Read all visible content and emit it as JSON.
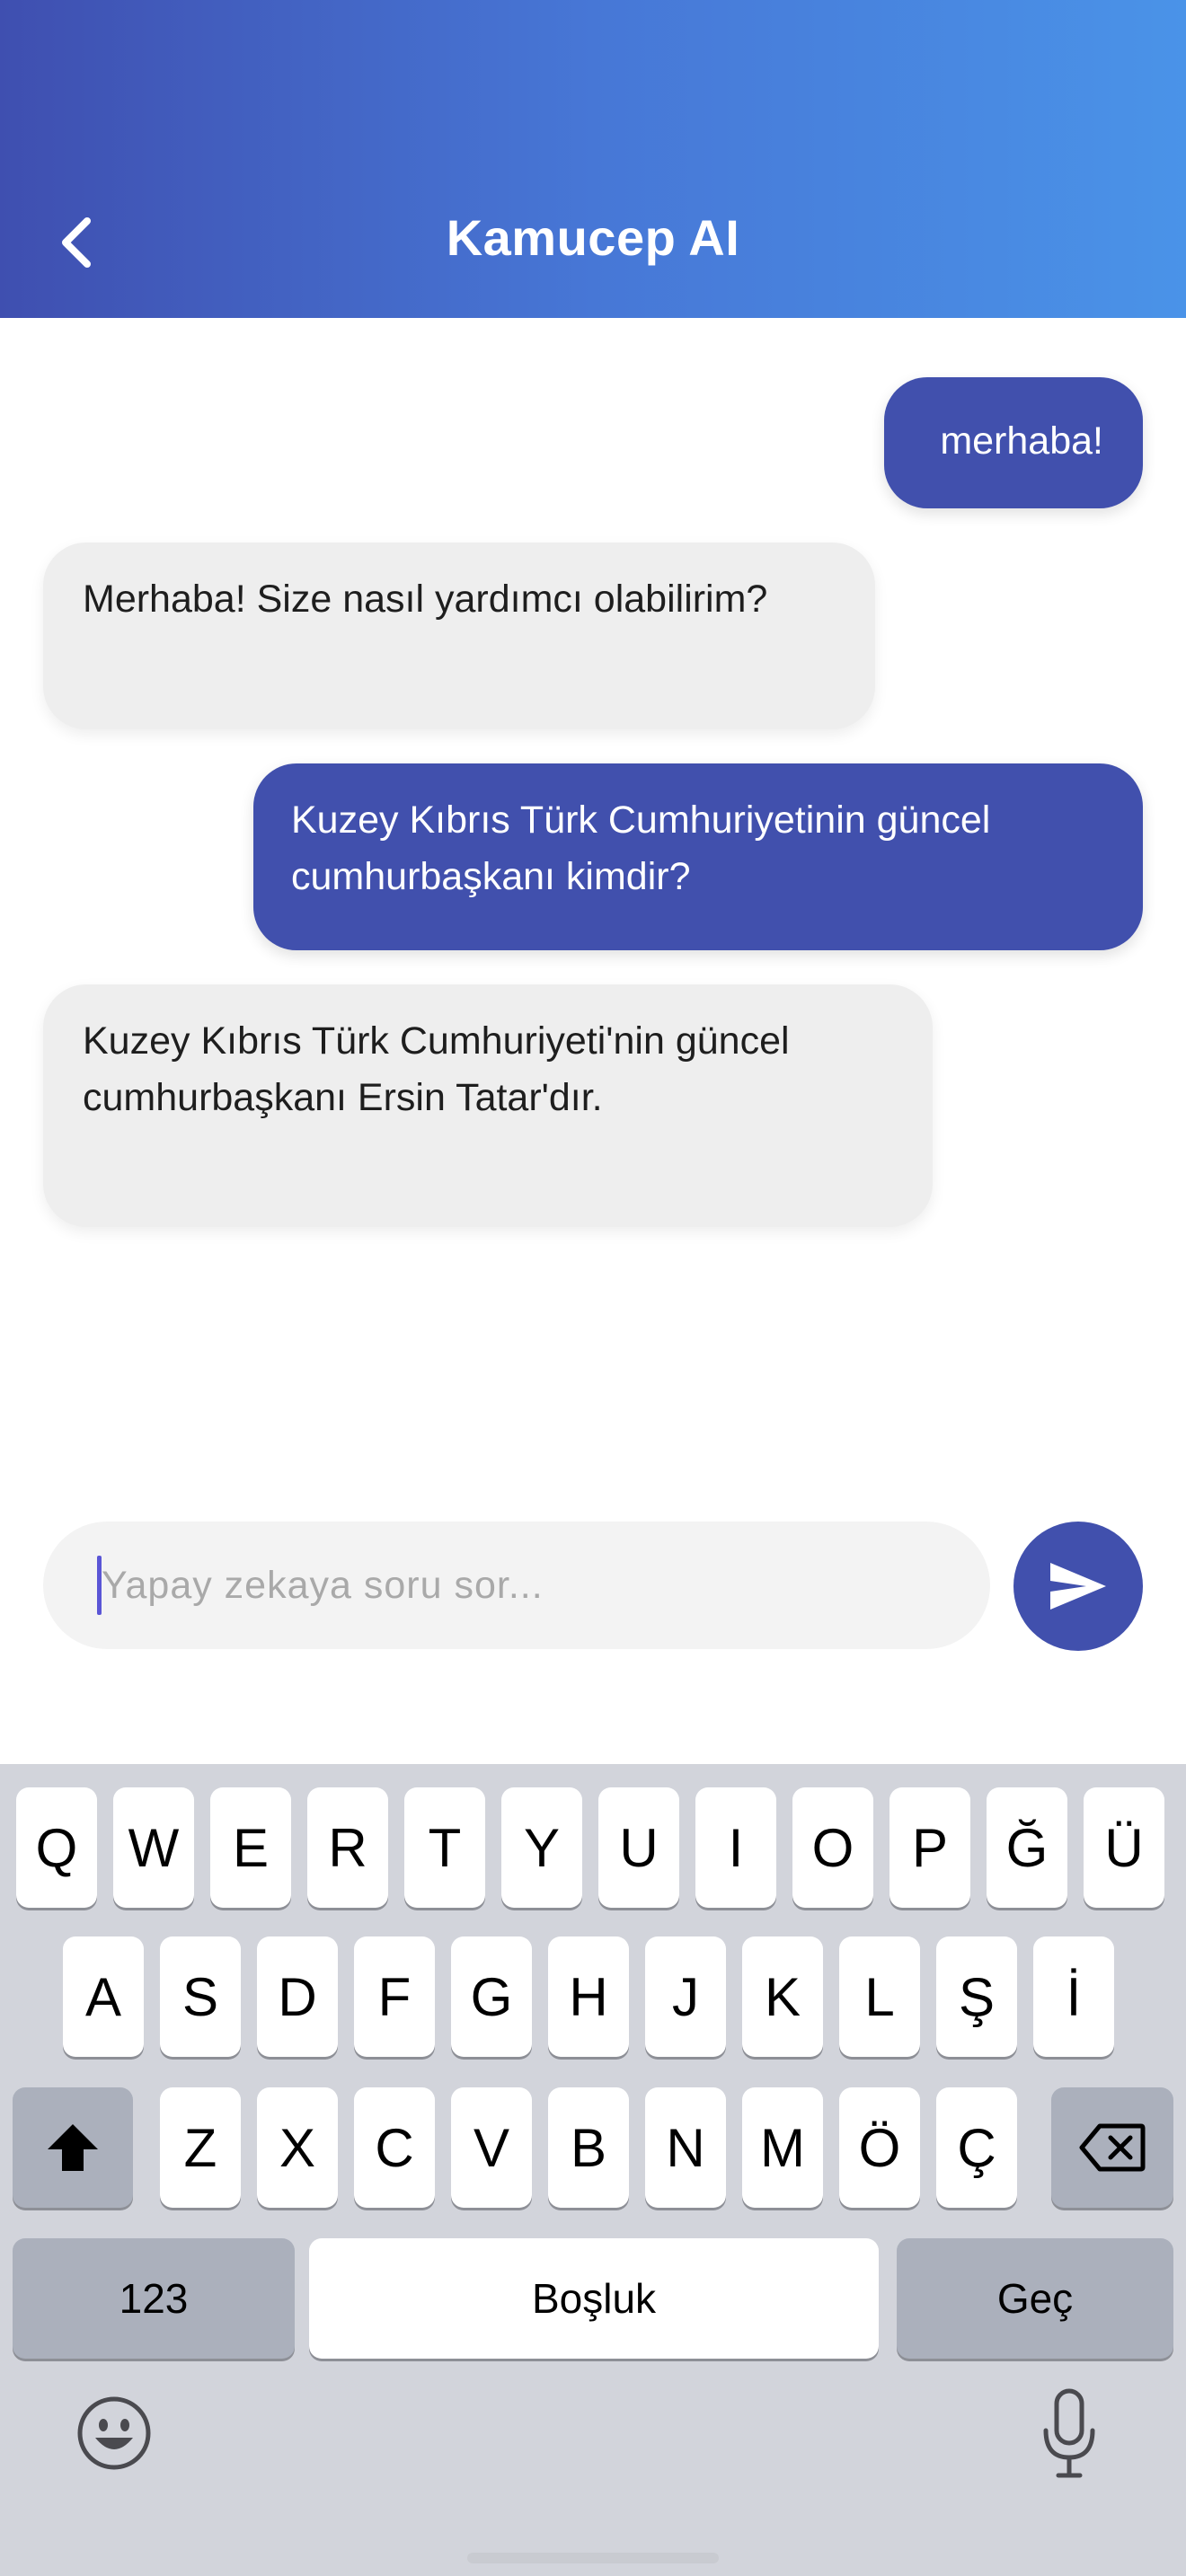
{
  "header": {
    "title": "Kamucep AI",
    "back_icon": "chevron-left-icon"
  },
  "messages": [
    {
      "role": "user",
      "text": "merhaba!"
    },
    {
      "role": "bot",
      "text": "Merhaba!  Size nasıl yardımcı olabilirim?"
    },
    {
      "role": "user",
      "line1": "Kuzey Kıbrıs Türk Cumhuriyetinin güncel",
      "line2": "cumhurbaşkanı kimdir?"
    },
    {
      "role": "bot",
      "line1": "Kuzey Kıbrıs Türk Cumhuriyeti'nin güncel",
      "line2": "cumhurbaşkanı Ersin Tatar'dır."
    }
  ],
  "composer": {
    "placeholder": "Yapay zekaya soru sor...",
    "send_icon": "send-icon"
  },
  "keyboard": {
    "row1": [
      "Q",
      "W",
      "E",
      "R",
      "T",
      "Y",
      "U",
      "I",
      "O",
      "P",
      "Ğ",
      "Ü"
    ],
    "row2": [
      "A",
      "S",
      "D",
      "F",
      "G",
      "H",
      "J",
      "K",
      "L",
      "Ş",
      "İ"
    ],
    "row3": [
      "Z",
      "X",
      "C",
      "V",
      "B",
      "N",
      "M",
      "Ö",
      "Ç"
    ],
    "numbers_label": "123",
    "space_label": "Boşluk",
    "return_label": "Geç",
    "shift_icon": "shift-icon",
    "backspace_icon": "backspace-icon",
    "emoji_icon": "emoji-icon",
    "mic_icon": "microphone-icon"
  },
  "colors": {
    "header_gradient_start": "#3f4fb0",
    "header_gradient_end": "#4a93e8",
    "user_bubble": "#4150ad",
    "bot_bubble": "#eeeeee",
    "keyboard_bg": "#d2d4db"
  }
}
